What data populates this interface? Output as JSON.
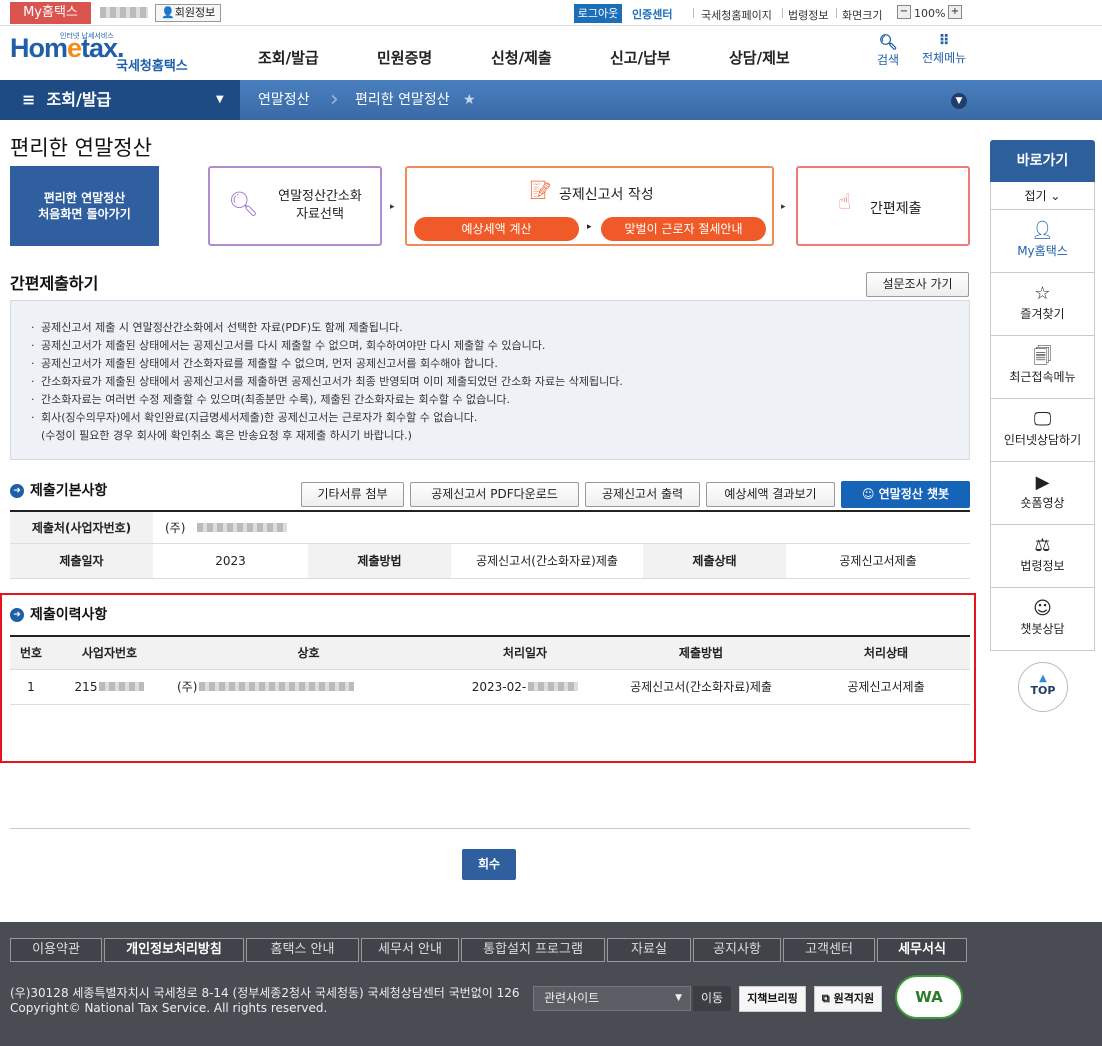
{
  "topbar": {
    "myhome": "My홈택스",
    "member_info": "회원정보",
    "logout": "로그아웃",
    "cert_center": "인증센터",
    "links": [
      "국세청홈페이지",
      "법령정보",
      "화면크기"
    ],
    "zoom_minus": "−",
    "zoom": "100%",
    "zoom_plus": "+"
  },
  "header": {
    "logo_small": "인터넷 납세서비스",
    "logo_text_a": "Hom",
    "logo_text_e": "e",
    "logo_text_b": "tax.",
    "logo_sub": "국세청홈택스",
    "gnb": [
      "조회/발급",
      "민원증명",
      "신청/제출",
      "신고/납부",
      "상담/제보"
    ],
    "search": "검색",
    "all_menu": "전체메뉴"
  },
  "navbar": {
    "main": "조회/발급",
    "crumbs": [
      "연말정산",
      "편리한 연말정산"
    ]
  },
  "page": {
    "title": "편리한 연말정산",
    "home_btn_line1": "편리한 연말정산",
    "home_btn_line2": "처음화면 돌아가기",
    "step1_line1": "연말정산간소화",
    "step1_line2": "자료선택",
    "step2_title": "공제신고서 작성",
    "step2_pill1": "예상세액 계산",
    "step2_pill2": "맞벌이 근로자 절세안내",
    "step3": "간편제출"
  },
  "simple_submit": {
    "title": "간편제출하기",
    "survey_btn": "설문조사 가기",
    "notices": [
      "공제신고서 제출 시 연말정산간소화에서 선택한 자료(PDF)도 함께 제출됩니다.",
      "공제신고서가 제출된 상태에서는 공제신고서를 다시 제출할 수 없으며, 회수하여야만 다시 제출할 수 있습니다.",
      "공제신고서가 제출된 상태에서 간소화자료를 제출할 수 없으며, 먼저 공제신고서를 회수해야 합니다.",
      "간소화자료가 제출된 상태에서 공제신고서를 제출하면 공제신고서가 최종 반영되며 이미 제출되었던 간소화 자료는 삭제됩니다.",
      "간소화자료는 여러번 수정 제출할 수 있으며(최종분만 수록), 제출된 간소화자료는 회수할 수 없습니다.",
      "회사(징수의무자)에서 확인완료(지급명세서제출)한 공제신고서는 근로자가 회수할 수 없습니다."
    ],
    "notice_tail": "(수정이 필요한 경우 회사에 확인취소 혹은 반송요청 후 재제출 하시기 바랍니다.)"
  },
  "basic_info": {
    "title": "제출기본사항",
    "buttons": [
      "기타서류 첨부",
      "공제신고서 PDF다운로드",
      "공제신고서 출력",
      "예상세액 결과보기"
    ],
    "chatbot": "연말정산 챗봇",
    "submit_to_label": "제출처(사업자번호)",
    "submit_to_value": "(주)",
    "date_label": "제출일자",
    "date_value": "2023",
    "method_label": "제출방법",
    "method_value": "공제신고서(간소화자료)제출",
    "status_label": "제출상태",
    "status_value": "공제신고서제출"
  },
  "history": {
    "title": "제출이력사항",
    "columns": [
      "번호",
      "사업자번호",
      "상호",
      "처리일자",
      "제출방법",
      "처리상태"
    ],
    "rows": [
      {
        "no": "1",
        "bizno": "215",
        "name": "(주)",
        "date": "2023-02-",
        "method": "공제신고서(간소화자료)제출",
        "status": "공제신고서제출"
      }
    ]
  },
  "action": {
    "withdraw": "회수"
  },
  "quick": {
    "head": "바로가기",
    "fold": "접기 ⌄",
    "items": [
      "My홈택스",
      "즐겨찾기",
      "최근접속메뉴",
      "인터넷상담하기",
      "숏폼영상",
      "법령정보",
      "챗봇상담"
    ],
    "top": "TOP"
  },
  "footer": {
    "menus": [
      "이용약관",
      "개인정보처리방침",
      "홈택스 안내",
      "세무서 안내",
      "통합설치 프로그램",
      "자료실",
      "공지사항",
      "고객센터",
      "세무서식"
    ],
    "address": "(우)30128 세종특별자치시 국세청로 8-14 (정부세종2청사 국세청동) 국세청상담센터 국번없이 126",
    "copyright": "Copyright© National Tax Service. All rights reserved.",
    "related_site": "관련사이트",
    "go": "이동",
    "btn1": "지책브리핑",
    "btn2": "원격지원",
    "wa": "WA"
  }
}
